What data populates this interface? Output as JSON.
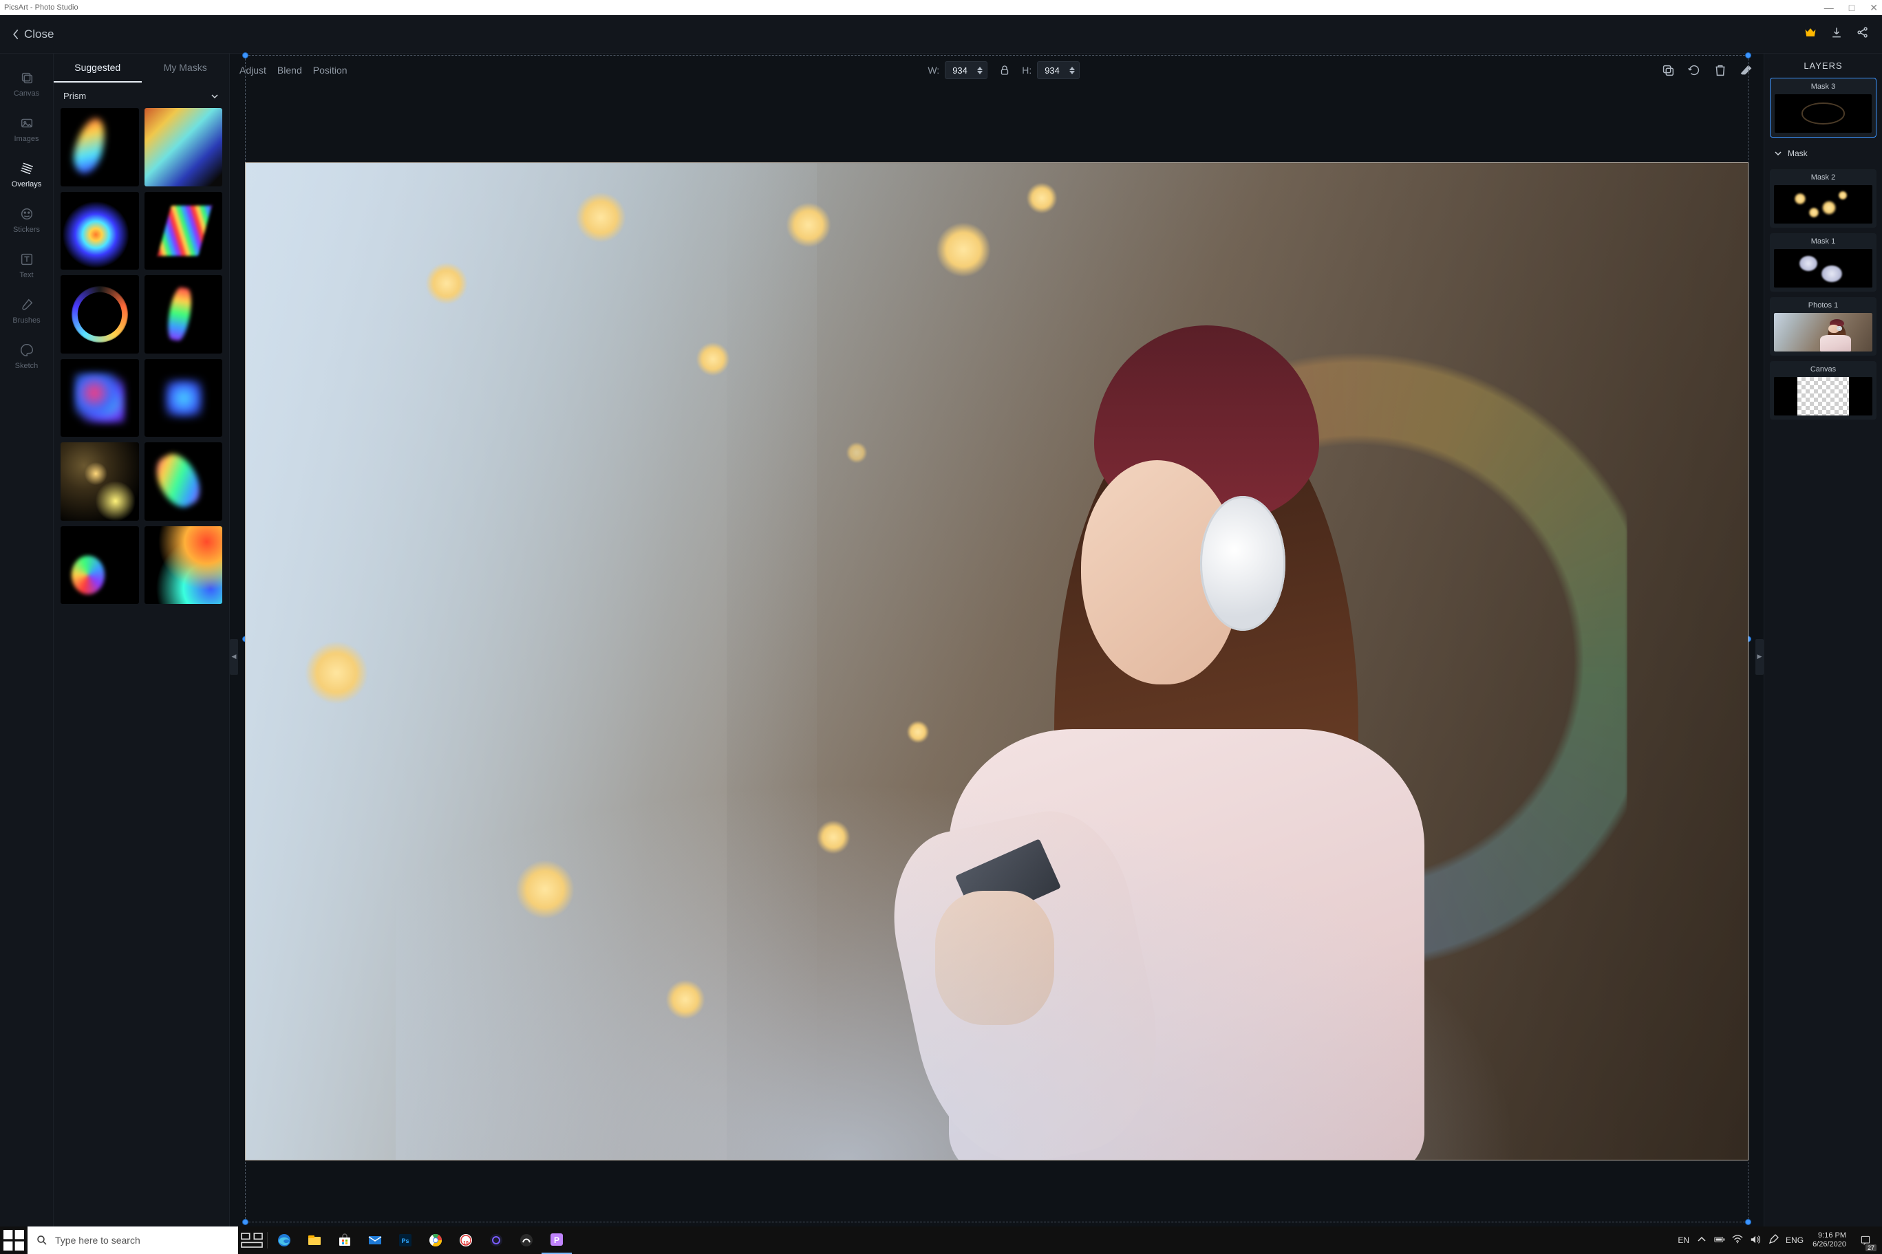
{
  "window": {
    "title": "PicsArt - Photo Studio"
  },
  "topbar": {
    "close": "Close"
  },
  "tools": [
    {
      "key": "canvas",
      "label": "Canvas"
    },
    {
      "key": "images",
      "label": "Images"
    },
    {
      "key": "overlays",
      "label": "Overlays"
    },
    {
      "key": "stickers",
      "label": "Stickers"
    },
    {
      "key": "text",
      "label": "Text"
    },
    {
      "key": "brushes",
      "label": "Brushes"
    },
    {
      "key": "sketch",
      "label": "Sketch"
    }
  ],
  "side": {
    "tabs": {
      "suggested": "Suggested",
      "mymasks": "My Masks"
    },
    "active_tab": "suggested",
    "category": "Prism",
    "thumb_count": 12
  },
  "canvasbar": {
    "adjust": "Adjust",
    "blend": "Blend",
    "position": "Position",
    "w_label": "W:",
    "h_label": "H:",
    "w_value": "934",
    "h_value": "934"
  },
  "layers": {
    "title": "LAYERS",
    "mask_section": "Mask",
    "items": [
      {
        "label": "Mask 3",
        "type": "mask",
        "selected": true
      },
      {
        "label": "Mask 2",
        "type": "mask",
        "selected": false
      },
      {
        "label": "Mask 1",
        "type": "mask",
        "selected": false
      },
      {
        "label": "Photos 1",
        "type": "photo",
        "selected": false
      },
      {
        "label": "Canvas",
        "type": "canvas",
        "selected": false
      }
    ]
  },
  "taskbar": {
    "search_placeholder": "Type here to search",
    "lang1": "EN",
    "lang2": "ENG",
    "time": "9:16 PM",
    "date": "6/26/2020",
    "notif_count": "27"
  }
}
